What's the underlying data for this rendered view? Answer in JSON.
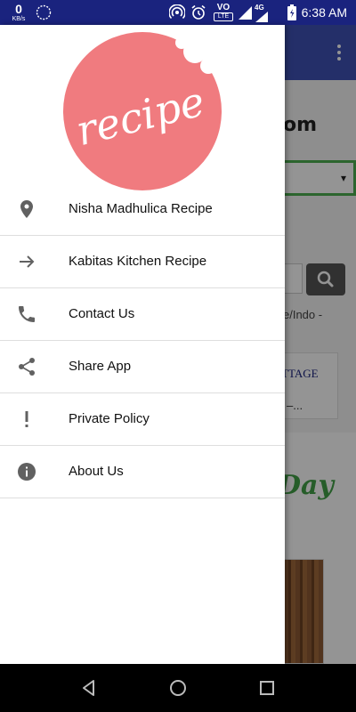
{
  "status_bar": {
    "net_speed_value": "0",
    "net_speed_unit": "KB/s",
    "network_badge": "4G",
    "volte_label": "VO",
    "lte_label": "LTE",
    "time": "6:38 AM",
    "background_color": "#1a237e"
  },
  "background_app": {
    "toolbar_color": "#3f51b5",
    "site_title_partial": "om",
    "select_caret": "▾",
    "breadcrumb_partial": "e/Indo -",
    "card_title_partial": "TTAGE",
    "card_subtitle_partial": "–...",
    "day_text_partial": "Day"
  },
  "drawer": {
    "logo_text": "recipe",
    "logo_color": "#f07b7f",
    "items": [
      {
        "label": "Nisha Madhulica Recipe",
        "icon": "location-pin-icon"
      },
      {
        "label": "Kabitas Kitchen Recipe",
        "icon": "arrow-right-icon"
      },
      {
        "label": "Contact Us",
        "icon": "phone-icon"
      },
      {
        "label": "Share App",
        "icon": "share-icon"
      },
      {
        "label": "Private Policy",
        "icon": "exclamation-icon"
      },
      {
        "label": "About Us",
        "icon": "info-icon"
      }
    ]
  },
  "navigation_bar": {
    "buttons": [
      "back-icon",
      "home-icon",
      "recents-icon"
    ]
  }
}
